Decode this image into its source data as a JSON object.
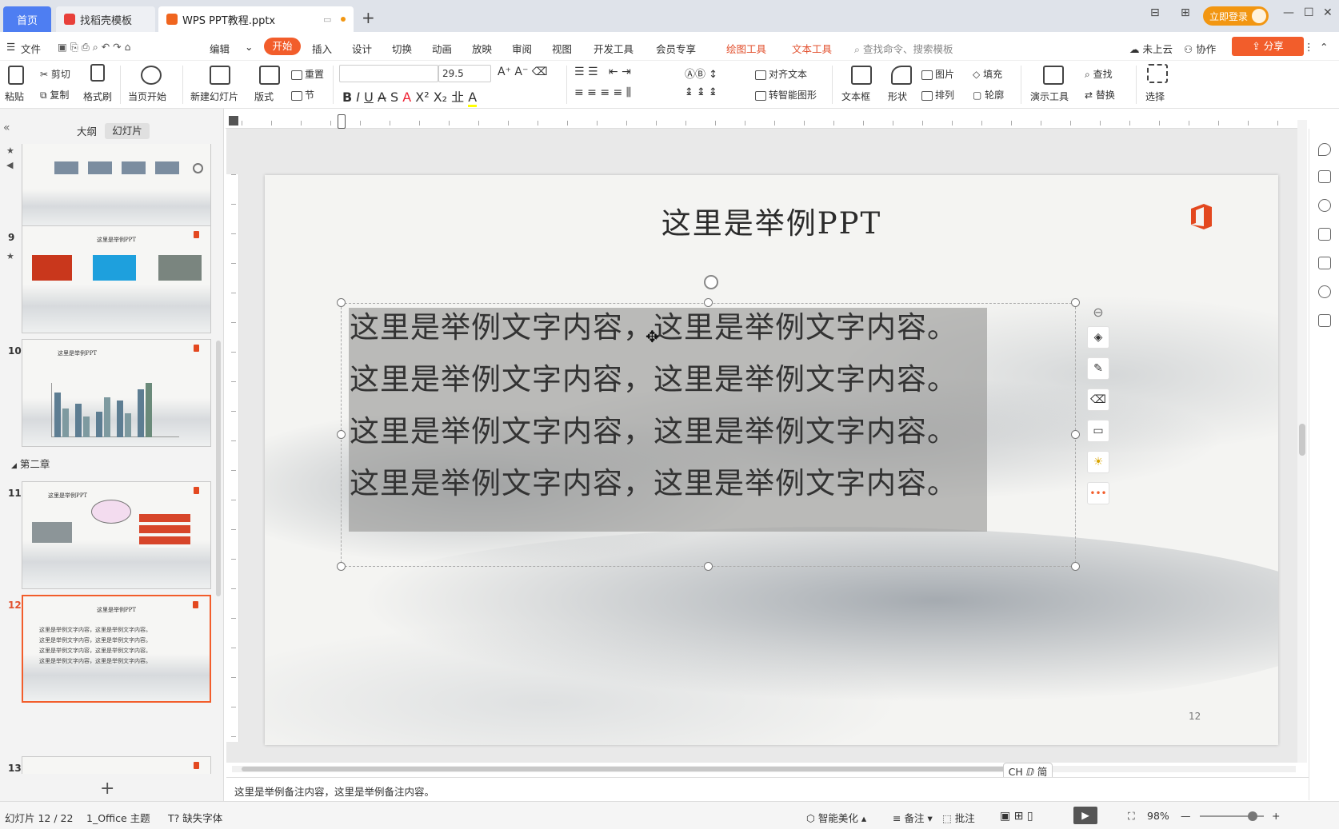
{
  "tabs": {
    "home": "首页",
    "templates": "找稻壳模板",
    "document": "WPS PPT教程.pptx"
  },
  "window": {
    "login_button": "立即登录"
  },
  "menu": {
    "file": "文件",
    "edit": "编辑",
    "items": [
      "开始",
      "插入",
      "设计",
      "切换",
      "动画",
      "放映",
      "审阅",
      "视图",
      "开发工具",
      "会员专享"
    ],
    "drawing_tools": "绘图工具",
    "text_tools": "文本工具",
    "search_placeholder": "查找命令、搜索模板",
    "cloud": "未上云",
    "collab": "协作",
    "share": "分享"
  },
  "ribbon": {
    "paste": "粘贴",
    "cut": "剪切",
    "copy": "复制",
    "format_painter": "格式刷",
    "from_current": "当页开始",
    "new_slide": "新建幻灯片",
    "layout": "版式",
    "reset": "重置",
    "section": "节",
    "font_size": "29.5",
    "align_text": "对齐文本",
    "smart_shape": "转智能图形",
    "textbox": "文本框",
    "shape": "形状",
    "picture": "图片",
    "fill": "填充",
    "arrange": "排列",
    "outline": "轮廓",
    "presenter_tools": "演示工具",
    "find": "查找",
    "replace": "替换",
    "select": "选择"
  },
  "panel": {
    "outline_tab": "大纲",
    "slides_tab": "幻灯片",
    "chapter_label": "第二章",
    "thumbnails": [
      {
        "num": "",
        "title": ""
      },
      {
        "num": "9",
        "title": "这里是举例PPT"
      },
      {
        "num": "10",
        "title": "这里是举例PPT"
      },
      {
        "num": "11",
        "title": "这里是举例PPT"
      },
      {
        "num": "12",
        "title": "这里是举例PPT"
      },
      {
        "num": "13",
        "title": ""
      }
    ],
    "thumb12_lines": [
      "这里是举例文字内容，这里是举例文字内容。",
      "这里是举例文字内容，这里是举例文字内容。",
      "这里是举例文字内容，这里是举例文字内容。",
      "这里是举例文字内容，这里是举例文字内容。"
    ]
  },
  "slide": {
    "title": "这里是举例PPT",
    "lines": [
      "这里是举例文字内容，这里是举例文字内容。",
      "这里是举例文字内容，这里是举例文字内容。",
      "这里是举例文字内容，这里是举例文字内容。",
      "这里是举例文字内容，这里是举例文字内容。"
    ],
    "page_number": "12",
    "logo_color": "#e3481f"
  },
  "notes": {
    "text": "这里是举例备注内容，这里是举例备注内容。"
  },
  "ime_badge": "CH ⅅ 简",
  "status": {
    "slide_counter": "幻灯片 12 / 22",
    "theme": "1_Office 主题",
    "missing_font": "缺失字体",
    "beautify": "智能美化",
    "notes": "备注",
    "comments": "批注",
    "zoom": "98%"
  },
  "colors": {
    "accent": "#f25d2b",
    "tab_active": "#4e7ef2",
    "login": "#f29611"
  }
}
